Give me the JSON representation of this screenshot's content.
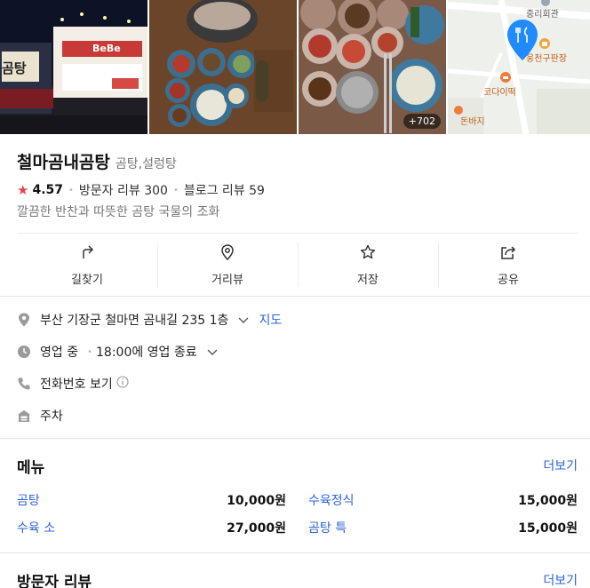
{
  "photos": {
    "count_badge": "+702",
    "storefront_sign": "곰탕",
    "storefront_brand": "BeBe"
  },
  "map": {
    "labels": [
      "중리회관",
      "웅천구판장",
      "코다이떡",
      "돈바지"
    ]
  },
  "place": {
    "name": "철마곰내곰탕",
    "category": "곰탕,설렁탕",
    "rating": "4.57",
    "visitor_reviews": "방문자 리뷰 300",
    "blog_reviews": "블로그 리뷰 59",
    "description": "깔끔한 반찬과 따뜻한 곰탕 국물의 조화"
  },
  "actions": [
    {
      "label": "길찾기",
      "icon": "directions-icon"
    },
    {
      "label": "거리뷰",
      "icon": "location-pin-icon"
    },
    {
      "label": "저장",
      "icon": "star-outline-icon"
    },
    {
      "label": "공유",
      "icon": "share-icon"
    }
  ],
  "info": {
    "address": "부산 기장군 철마면 곰내길 235 1층",
    "map_link": "지도",
    "status": "영업 중",
    "hours": "18:00에 영업 종료",
    "phone": "전화번호 보기",
    "parking": "주차"
  },
  "menu": {
    "title": "메뉴",
    "more": "더보기",
    "items": [
      {
        "name": "곰탕",
        "price": "10,000원"
      },
      {
        "name": "수육정식",
        "price": "15,000원"
      },
      {
        "name": "수육 소",
        "price": "27,000원"
      },
      {
        "name": "곰탕 특",
        "price": "15,000원"
      }
    ]
  },
  "reviews": {
    "title": "방문자 리뷰",
    "more": "더보기"
  },
  "colors": {
    "accent_link": "#2b63d9",
    "rating_star": "#e8434d",
    "map_pin": "#1f8bff"
  }
}
